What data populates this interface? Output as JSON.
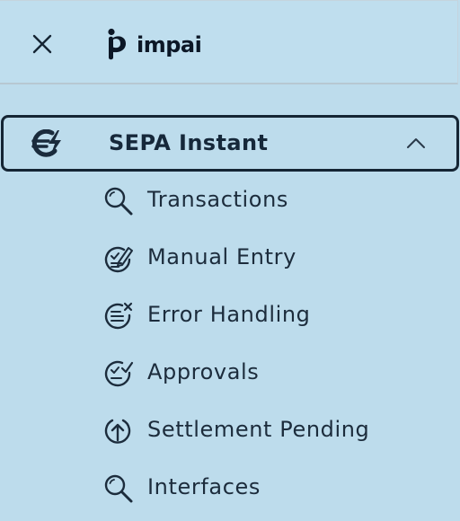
{
  "header": {
    "close_icon": "close-icon",
    "logo_text": "impai"
  },
  "section": {
    "icon": "sepa-instant-icon",
    "title": "SEPA Instant",
    "expanded": true,
    "chevron_icon": "chevron-up-icon"
  },
  "menu": {
    "items": [
      {
        "label": "Transactions",
        "icon": "search-icon"
      },
      {
        "label": "Manual Entry",
        "icon": "edit-checklist-icon"
      },
      {
        "label": "Error Handling",
        "icon": "error-list-icon"
      },
      {
        "label": "Approvals",
        "icon": "approval-check-icon"
      },
      {
        "label": "Settlement Pending",
        "icon": "upload-circle-icon"
      },
      {
        "label": "Interfaces",
        "icon": "search-icon"
      }
    ]
  },
  "colors": {
    "background": "#bddcec",
    "text": "#1c2c3c",
    "border": "#152534"
  }
}
